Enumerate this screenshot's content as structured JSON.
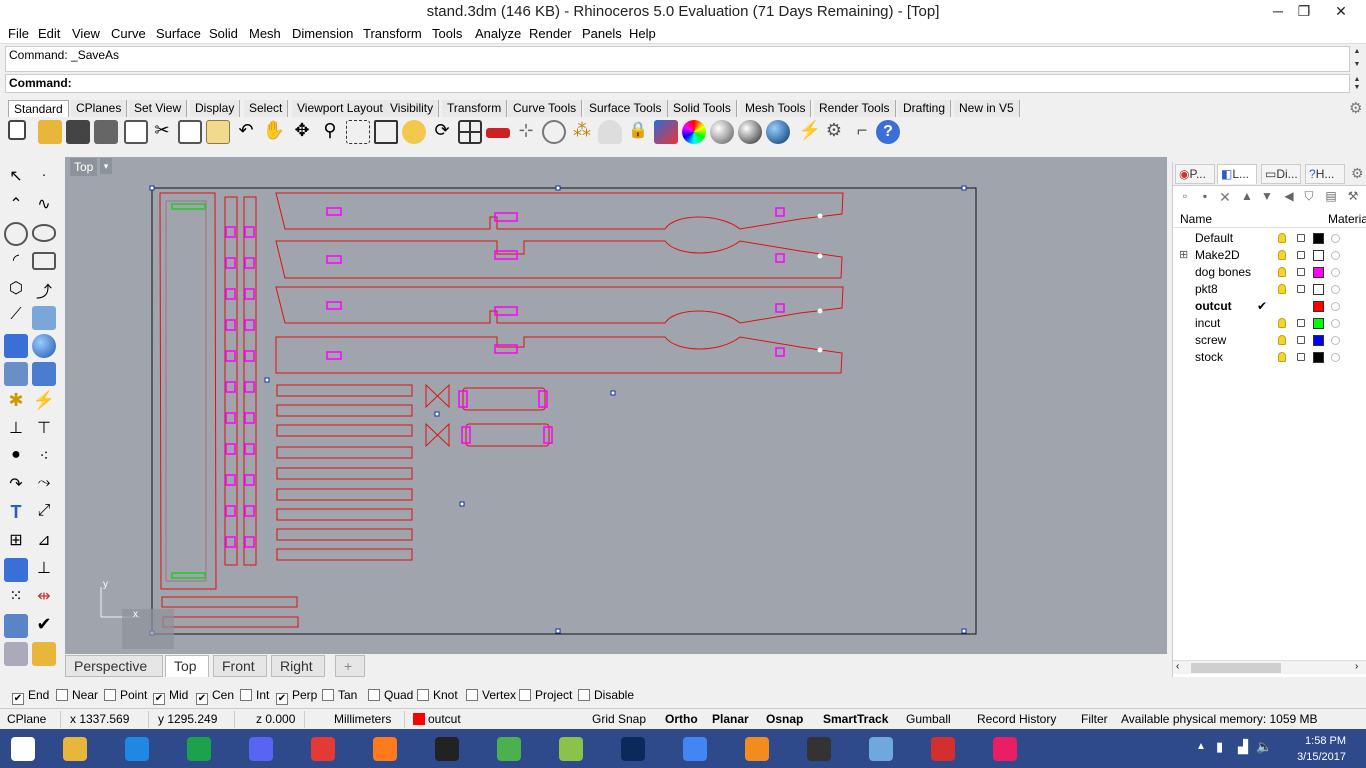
{
  "window": {
    "title": "stand.3dm (146 KB) - Rhinoceros 5.0 Evaluation (71 Days Remaining) - [Top]",
    "minimize": "─",
    "maximize": "❐",
    "close": "✕"
  },
  "menu": [
    "File",
    "Edit",
    "View",
    "Curve",
    "Surface",
    "Solid",
    "Mesh",
    "Dimension",
    "Transform",
    "Tools",
    "Analyze",
    "Render",
    "Panels",
    "Help"
  ],
  "command": {
    "history": "Command: _SaveAs",
    "prompt": "Command:"
  },
  "toolbar_tabs": [
    "Standard",
    "CPlanes",
    "Set View",
    "Display",
    "Select",
    "Viewport Layout",
    "Visibility",
    "Transform",
    "Curve Tools",
    "Surface Tools",
    "Solid Tools",
    "Mesh Tools",
    "Render Tools",
    "Drafting",
    "New in V5"
  ],
  "toolbar_active_tab": "Standard",
  "toolbar_icons": [
    "new-icon",
    "open-icon",
    "save-icon",
    "print-icon",
    "import-icon",
    "cut-icon",
    "copy-icon",
    "paste-icon",
    "undo-icon",
    "pan-icon",
    "move-view-icon",
    "zoom-icon",
    "zoom-window-icon",
    "zoom-extents-icon",
    "zoom-selected-icon",
    "rotate-view-icon",
    "four-viewports-icon",
    "car-icon",
    "grid-icon",
    "snap-icon",
    "point-icon",
    "light-icon",
    "lock-icon",
    "layer-icon",
    "color-wheel-icon",
    "shaded-sphere-icon",
    "rendered-sphere-icon",
    "render-sphere-icon",
    "highlight-icon",
    "settings-icon",
    "options-icon",
    "help-icon"
  ],
  "viewport": {
    "name": "Top",
    "dropdown": "▾",
    "axis_y": "y",
    "axis_x": "x"
  },
  "viewport_tabs": [
    "Perspective",
    "Top",
    "Front",
    "Right"
  ],
  "viewport_active": "Top",
  "viewport_add": "+",
  "panel": {
    "tabs": [
      "P...",
      "L...",
      "Di...",
      "H..."
    ],
    "active": "L...",
    "col_name": "Name",
    "col_material": "Material",
    "layers": [
      {
        "name": "Default",
        "color": "#000000",
        "current": false,
        "expand": ""
      },
      {
        "name": "Make2D",
        "color": "#ffffff",
        "current": false,
        "expand": "⊞"
      },
      {
        "name": "dog bones",
        "color": "#ff00ff",
        "current": false,
        "expand": ""
      },
      {
        "name": "pkt8",
        "color": "#ffffff",
        "current": false,
        "expand": ""
      },
      {
        "name": "outcut",
        "color": "#ff0000",
        "current": true,
        "expand": "",
        "check": "✔"
      },
      {
        "name": "incut",
        "color": "#00ff00",
        "current": false,
        "expand": ""
      },
      {
        "name": "screw",
        "color": "#0000ff",
        "current": false,
        "expand": ""
      },
      {
        "name": "stock",
        "color": "#000000",
        "current": false,
        "expand": ""
      }
    ]
  },
  "osnaps": [
    {
      "label": "End",
      "checked": true
    },
    {
      "label": "Near",
      "checked": false
    },
    {
      "label": "Point",
      "checked": false
    },
    {
      "label": "Mid",
      "checked": true
    },
    {
      "label": "Cen",
      "checked": true
    },
    {
      "label": "Int",
      "checked": false
    },
    {
      "label": "Perp",
      "checked": true
    },
    {
      "label": "Tan",
      "checked": false
    },
    {
      "label": "Quad",
      "checked": false
    },
    {
      "label": "Knot",
      "checked": false
    },
    {
      "label": "Vertex",
      "checked": false
    },
    {
      "label": "Project",
      "checked": false
    },
    {
      "label": "Disable",
      "checked": false
    }
  ],
  "status": {
    "cplane": "CPlane",
    "x": "x 1337.569",
    "y": "y 1295.249",
    "z": "z 0.000",
    "units": "Millimeters",
    "layer": "outcut",
    "layer_color": "#ff0000",
    "grid_snap": "Grid Snap",
    "ortho": "Ortho",
    "planar": "Planar",
    "osnap": "Osnap",
    "smarttrack": "SmartTrack",
    "gumball": "Gumball",
    "record_history": "Record History",
    "filter": "Filter",
    "memory": "Available physical memory: 1059 MB"
  },
  "taskbar": {
    "apps": [
      "start-icon",
      "file-explorer-icon",
      "internet-explorer-icon",
      "store-icon",
      "discord-icon",
      "game-icon",
      "firefox-icon",
      "h-app-icon",
      "globe-icon",
      "chart-app-icon",
      "photoshop-icon",
      "chrome-icon",
      "fusion-icon",
      "rhino-icon",
      "photos-icon",
      "paint-icon",
      "puzzle-icon"
    ],
    "time": "1:58 PM",
    "date": "3/15/2017"
  }
}
